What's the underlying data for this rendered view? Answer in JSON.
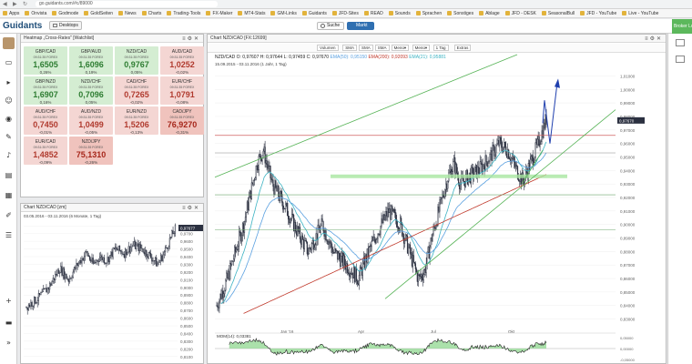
{
  "browser": {
    "url": "go.guidants.com/#c/89000",
    "bookmarks": [
      "Apps",
      "Onvista",
      "Godmode",
      "GoldSeiten",
      "News",
      "Charts",
      "Trading-Tools",
      "FX-Maker",
      "MT4-Stats",
      "GM-Links",
      "Guidants",
      "JFD-Sites",
      "READ",
      "Sounds",
      "Sprachen",
      "Sonstiges",
      "Ablage",
      "JFD - DESK",
      "SeasonalBull",
      "JFD - YouTube",
      "Live - YouTube"
    ]
  },
  "app": {
    "logo": "Guidants",
    "desktop_label": "Desktops",
    "search_label": "Suche",
    "market_label": "Markt",
    "broker_label": "Broker Login"
  },
  "heatmap": {
    "title": "Heatmap „Cross-Rates\" [Watchlist]",
    "cells": [
      {
        "pair": "GBP/CAD",
        "sub": "09:31:35 FOREX",
        "value": "1,6505",
        "change": "0,26%",
        "tone": "pos"
      },
      {
        "pair": "GBP/AUD",
        "sub": "09:31:35 FOREX",
        "value": "1,6096",
        "change": "0,19%",
        "tone": "pos"
      },
      {
        "pair": "NZD/CAD",
        "sub": "09:31:35 FOREX",
        "value": "0,9767",
        "change": "0,05%",
        "tone": "pos"
      },
      {
        "pair": "AUD/CAD",
        "sub": "09:31:35 FOREX",
        "value": "1,0252",
        "change": "-0,02%",
        "tone": "neg"
      },
      {
        "pair": "GBP/NZD",
        "sub": "09:31:35 FOREX",
        "value": "1,6907",
        "change": "0,16%",
        "tone": "pos"
      },
      {
        "pair": "NZD/CHF",
        "sub": "09:31:35 FOREX",
        "value": "0,7096",
        "change": "0,05%",
        "tone": "pos"
      },
      {
        "pair": "CAD/CHF",
        "sub": "09:31:35 FOREX",
        "value": "0,7265",
        "change": "-0,02%",
        "tone": "neg"
      },
      {
        "pair": "EUR/CHF",
        "sub": "09:31:35 FOREX",
        "value": "1,0791",
        "change": "-0,08%",
        "tone": "neg"
      },
      {
        "pair": "AUD/CHF",
        "sub": "09:31:35 FOREX",
        "value": "0,7450",
        "change": "-0,01%",
        "tone": "neg"
      },
      {
        "pair": "AUD/NZD",
        "sub": "09:31:35 FOREX",
        "value": "1,0499",
        "change": "-0,05%",
        "tone": "neg"
      },
      {
        "pair": "EUR/NZD",
        "sub": "09:31:35 FOREX",
        "value": "1,5206",
        "change": "-0,13%",
        "tone": "neg"
      },
      {
        "pair": "CAD/JPY",
        "sub": "09:31:35 FOREX",
        "value": "76,9270",
        "change": "-0,31%",
        "tone": "negs"
      },
      {
        "pair": "EUR/CAD",
        "sub": "09:31:35 FOREX",
        "value": "1,4852",
        "change": "-0,09%",
        "tone": "neg"
      },
      {
        "pair": "NZD/JPY",
        "sub": "09:31:35 FOREX",
        "value": "75,1310",
        "change": "-0,26%",
        "tone": "negs"
      }
    ]
  },
  "smallchart": {
    "title": "Chart NZD/CAD [zm]",
    "subtitle": "03.05.2016 - 03.11.2016 (6 Monate, 1 Tag)",
    "last_value": "0,97677",
    "ticks": [
      "0,9800",
      "0,9700",
      "0,9600",
      "0,9500",
      "0,9400",
      "0,9300",
      "0,9200",
      "0,9100",
      "0,9000",
      "0,8900",
      "0,8800",
      "0,8700",
      "0,8600",
      "0,8500",
      "0,8400",
      "0,8300",
      "0,8200",
      "0,8100"
    ]
  },
  "bigchart": {
    "title": "Chart NZD/CAD [FX:12699]",
    "toolbar": [
      "Volumen",
      "SMA",
      "SMA",
      "SMA",
      "Menü▾",
      "Menü▾",
      "1 Tag",
      "Extras"
    ],
    "legend": {
      "pair": "NZD/CAD",
      "ohlc": "O: 0,97607  H: 0,97644  L: 0,97459  C: 0,97670",
      "ema1": "EMA(50): 0,95150",
      "ema2": "EMA(200): 0,92093",
      "ema3": "EMA(21): 0,95881"
    },
    "date_range": "15.09.2015 - 03.11.2016 (1 Jahr, 1 Tag)",
    "last_price": "0,97670",
    "x_labels": [
      "Jan '16",
      "Apr",
      "Jul",
      "Okt"
    ],
    "y_ticks": [
      "1,01000",
      "1,00000",
      "0,99000",
      "0,98000",
      "0,97000",
      "0,96000",
      "0,95000",
      "0,94000",
      "0,93000",
      "0,92000",
      "0,91000",
      "0,90000",
      "0,89000",
      "0,88000",
      "0,87000",
      "0,86000",
      "0,85000",
      "0,84000",
      "0,83000"
    ],
    "indicator_label": "MOM(14): 0,03381",
    "indicator_ticks": [
      "0,05000",
      "0,00000",
      "-0,05000"
    ]
  },
  "colors": {
    "accent": "#2f6fb1",
    "candle_up": "#2b3040",
    "ema50": "#5aa0e0",
    "ema200": "#c0392b",
    "ema21": "#3cb3c3",
    "trend_green": "#56b356",
    "resistance_red": "#d06060",
    "support_green_band": "#a8e6a0",
    "arrow": "#1f3fae"
  }
}
